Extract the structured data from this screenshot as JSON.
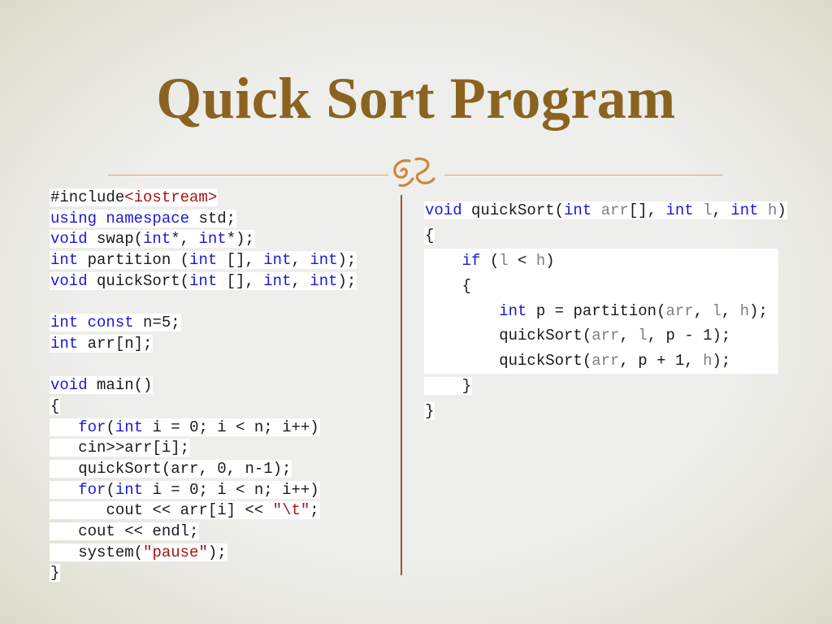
{
  "slide": {
    "title": "Quick Sort Program"
  },
  "left_code": {
    "l1_a": "#include",
    "l1_b": "<iostream>",
    "l2_a": "using",
    "l2_b": " ",
    "l2_c": "namespace",
    "l2_d": " std;",
    "l3_a": "void",
    "l3_b": " swap(",
    "l3_c": "int",
    "l3_d": "*, ",
    "l3_e": "int",
    "l3_f": "*);",
    "l4_a": "int",
    "l4_b": " partition (",
    "l4_c": "int",
    "l4_d": " [], ",
    "l4_e": "int",
    "l4_f": ", ",
    "l4_g": "int",
    "l4_h": ");",
    "l5_a": "void",
    "l5_b": " quickSort(",
    "l5_c": "int",
    "l5_d": " [], ",
    "l5_e": "int",
    "l5_f": ", ",
    "l5_g": "int",
    "l5_h": ");",
    "l7_a": "int",
    "l7_b": " ",
    "l7_c": "const",
    "l7_d": " n=5;",
    "l8_a": "int",
    "l8_b": " arr[n];",
    "l10_a": "void",
    "l10_b": " main()",
    "l11": "{",
    "l12_indent": "   ",
    "l12_a": "for",
    "l12_b": "(",
    "l12_c": "int",
    "l12_d": " i = 0; i < n; i++)",
    "l13": "cin>>arr[i];",
    "l14": "quickSort(arr, 0, n-1);",
    "l15_a": "for",
    "l15_b": "(",
    "l15_c": "int",
    "l15_d": " i = 0; i < n; i++)",
    "l16_a": "cout << arr[i] << ",
    "l16_b": "\"\\t\"",
    "l16_c": ";",
    "l17": "cout << endl;",
    "l18_a": "system(",
    "l18_b": "\"pause\"",
    "l18_c": ");",
    "l19": "}"
  },
  "right_code": {
    "r1_a": "void",
    "r1_b": " quickSort(",
    "r1_c": "int",
    "r1_d": " ",
    "r1_e": "arr",
    "r1_f": "[], ",
    "r1_g": "int",
    "r1_h": " ",
    "r1_i": "l",
    "r1_j": ", ",
    "r1_k": "int",
    "r1_l": " ",
    "r1_m": "h",
    "r1_n": ")",
    "r2": "{",
    "r3_a": "if",
    "r3_b": " (",
    "r3_c": "l",
    "r3_d": " < ",
    "r3_e": "h",
    "r3_f": ")",
    "r4": "{",
    "r5_a": "int",
    "r5_b": " p = partition(",
    "r5_c": "arr",
    "r5_d": ", ",
    "r5_e": "l",
    "r5_f": ", ",
    "r5_g": "h",
    "r5_h": ");",
    "r6_a": "quickSort(",
    "r6_b": "arr",
    "r6_c": ", ",
    "r6_d": "l",
    "r6_e": ", p - 1);",
    "r7_a": "quickSort(",
    "r7_b": "arr",
    "r7_c": ", p + 1, ",
    "r7_d": "h",
    "r7_e": ");",
    "r8": "}",
    "r9": "}"
  },
  "colors": {
    "title": "#8b6321",
    "keyword": "#1a1ad6",
    "string": "#a31515",
    "param": "#808080",
    "divider": "#a0522d",
    "rule": "#d4a975"
  },
  "icons": {
    "flourish": "decorative-flourish-icon"
  }
}
